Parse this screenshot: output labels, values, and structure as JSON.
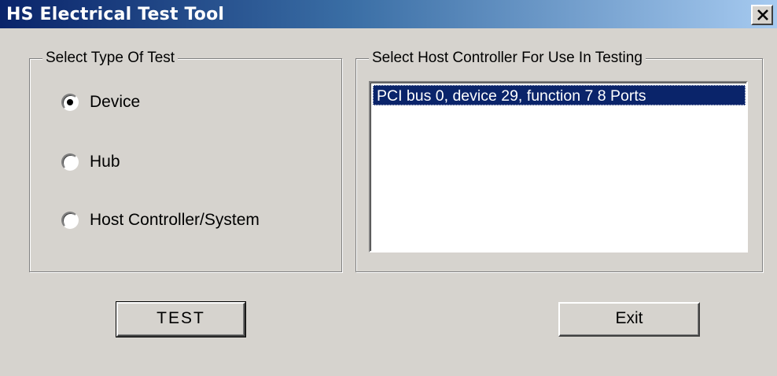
{
  "window": {
    "title": "HS Electrical Test Tool"
  },
  "test_type": {
    "group_title": "Select Type Of Test",
    "options": [
      {
        "label": "Device",
        "checked": true
      },
      {
        "label": "Hub",
        "checked": false
      },
      {
        "label": "Host Controller/System",
        "checked": false
      }
    ]
  },
  "host_controller": {
    "group_title": "Select Host Controller For Use In Testing",
    "items": [
      "PCI bus 0, device 29, function 7  8 Ports"
    ],
    "selected_index": 0
  },
  "buttons": {
    "test_label": "TEST",
    "exit_label": "Exit"
  },
  "colors": {
    "face": "#d6d3ce",
    "title_active": "#0a246a",
    "selection": "#0a246a"
  }
}
